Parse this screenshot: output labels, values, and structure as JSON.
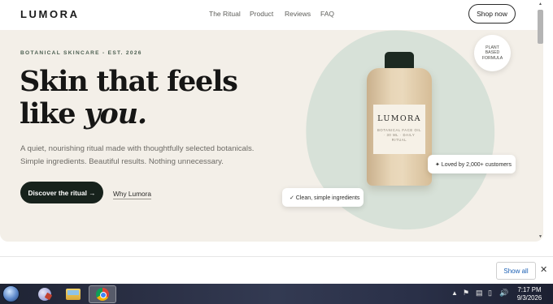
{
  "header": {
    "logo": "LUMORA",
    "nav": [
      "The Ritual",
      "Product",
      "Reviews",
      "FAQ"
    ],
    "cta": "Shop now"
  },
  "hero": {
    "eyebrow": "BOTANICAL SKINCARE - EST. 2026",
    "headline_line1": "Skin that feels",
    "headline_line2_prefix": "like ",
    "headline_line2_em": "you.",
    "subtext_line1": "A quiet, nourishing ritual made with thoughtfully selected botanicals.",
    "subtext_line2": "Simple ingredients. Beautiful results. Nothing unnecessary.",
    "primary_cta": "Discover the ritual →",
    "secondary_cta": "Why Lumora",
    "product": {
      "brand": "LUMORA",
      "description": "BOTANICAL FACE OIL · 30 ML · DAILY RITUAL"
    },
    "badge": "PLANT BASED FORMULA",
    "pill_loved": "✦ Loved by 2,000+ customers",
    "pill_clean": "✓ Clean, simple ingredients"
  },
  "download_shelf": {
    "show_all": "Show all",
    "close": "✕"
  },
  "taskbar": {
    "time": "7:17 PM",
    "date": "9/3/2026",
    "apps": [
      "paint-icon",
      "file-explorer-icon",
      "chrome-icon"
    ]
  },
  "colors": {
    "hero_bg": "#f3efe8",
    "blob": "#d7e1d8",
    "cta_dark": "#17221c",
    "accent_green": "#4d6052"
  }
}
